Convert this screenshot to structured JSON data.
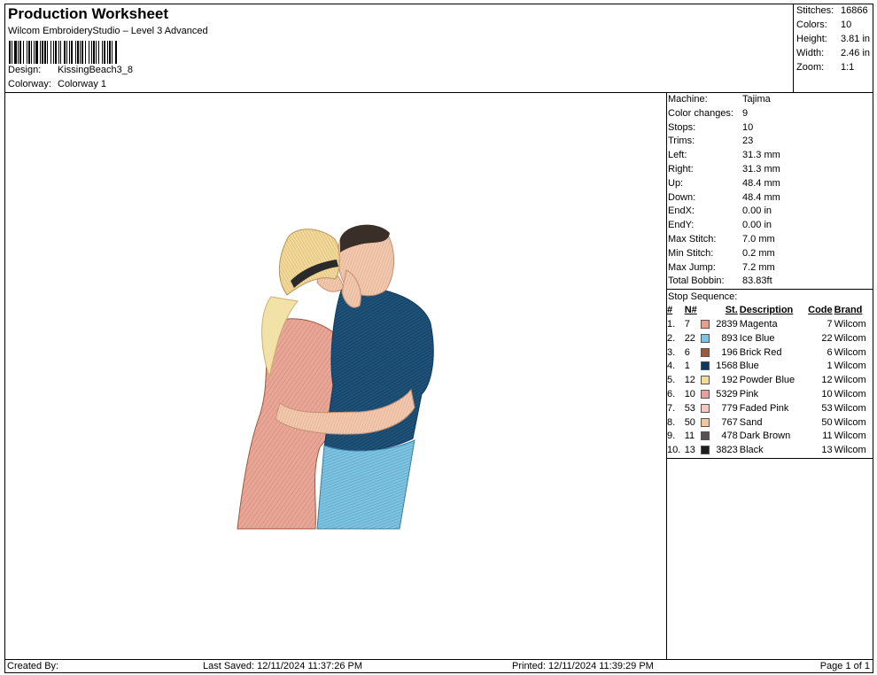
{
  "header": {
    "title": "Production Worksheet",
    "subtitle": "Wilcom EmbroideryStudio – Level 3 Advanced",
    "design_label": "Design:",
    "design": "KissingBeach3_8",
    "colorway_label": "Colorway:",
    "colorway": "Colorway 1"
  },
  "stats": [
    {
      "label": "Stitches:",
      "value": "16866"
    },
    {
      "label": "Colors:",
      "value": "10"
    },
    {
      "label": "Height:",
      "value": "3.81 in"
    },
    {
      "label": "Width:",
      "value": "2.46 in"
    },
    {
      "label": "Zoom:",
      "value": "1:1"
    }
  ],
  "info": [
    {
      "label": "Machine:",
      "value": "Tajima"
    },
    {
      "label": "Color changes:",
      "value": "9"
    },
    {
      "label": "Stops:",
      "value": "10"
    },
    {
      "label": "Trims:",
      "value": "23"
    },
    {
      "label": "Left:",
      "value": "31.3 mm"
    },
    {
      "label": "Right:",
      "value": "31.3 mm"
    },
    {
      "label": "Up:",
      "value": "48.4 mm"
    },
    {
      "label": "Down:",
      "value": "48.4 mm"
    },
    {
      "label": "EndX:",
      "value": "0.00 in"
    },
    {
      "label": "EndY:",
      "value": "0.00 in"
    },
    {
      "label": "Max Stitch:",
      "value": "7.0 mm"
    },
    {
      "label": "Min Stitch:",
      "value": "0.2 mm"
    },
    {
      "label": "Max Jump:",
      "value": "7.2 mm"
    },
    {
      "label": "Total Bobbin:",
      "value": "83.83ft"
    }
  ],
  "stop_sequence": {
    "label": "Stop Sequence:",
    "headers": {
      "idx": "#",
      "n": "N#",
      "st": "St.",
      "desc": "Description",
      "code": "Code",
      "brand": "Brand"
    },
    "rows": [
      {
        "idx": "1.",
        "n": "7",
        "color": "#e6a08c",
        "st": "2839",
        "desc": "Magenta",
        "code": "7",
        "brand": "Wilcom"
      },
      {
        "idx": "2.",
        "n": "22",
        "color": "#7ec3e6",
        "st": "893",
        "desc": "Ice Blue",
        "code": "22",
        "brand": "Wilcom"
      },
      {
        "idx": "3.",
        "n": "6",
        "color": "#a0583c",
        "st": "196",
        "desc": "Brick Red",
        "code": "6",
        "brand": "Wilcom"
      },
      {
        "idx": "4.",
        "n": "1",
        "color": "#0a3a64",
        "st": "1568",
        "desc": "Blue",
        "code": "1",
        "brand": "Wilcom"
      },
      {
        "idx": "5.",
        "n": "12",
        "color": "#f2dc96",
        "st": "192",
        "desc": "Powder Blue",
        "code": "12",
        "brand": "Wilcom"
      },
      {
        "idx": "6.",
        "n": "10",
        "color": "#e6a0a0",
        "st": "5329",
        "desc": "Pink",
        "code": "10",
        "brand": "Wilcom"
      },
      {
        "idx": "7.",
        "n": "53",
        "color": "#f2c8c0",
        "st": "779",
        "desc": "Faded Pink",
        "code": "53",
        "brand": "Wilcom"
      },
      {
        "idx": "8.",
        "n": "50",
        "color": "#f0c8a0",
        "st": "767",
        "desc": "Sand",
        "code": "50",
        "brand": "Wilcom"
      },
      {
        "idx": "9.",
        "n": "11",
        "color": "#5a5050",
        "st": "478",
        "desc": "Dark Brown",
        "code": "11",
        "brand": "Wilcom"
      },
      {
        "idx": "10.",
        "n": "13",
        "color": "#1e1e1e",
        "st": "3823",
        "desc": "Black",
        "code": "13",
        "brand": "Wilcom"
      }
    ]
  },
  "footer": {
    "created_by": "Created By:",
    "last_saved": "Last Saved: 12/11/2024 11:37:26 PM",
    "printed": "Printed: 12/11/2024 11:39:29 PM",
    "page": "Page 1 of 1"
  }
}
